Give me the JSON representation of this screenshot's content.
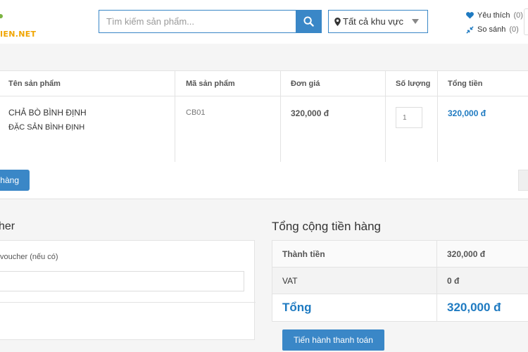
{
  "header": {
    "logo_text": "IEN.NET",
    "search_placeholder": "Tìm kiếm sản phẩm...",
    "region": "Tất cả khu vực",
    "favorites_label": "Yêu thích",
    "favorites_count": "(0)",
    "compare_label": "So sánh",
    "compare_count": "(0)"
  },
  "cart": {
    "columns": [
      "Tên sản phẩm",
      "Mã sản phẩm",
      "Đơn giá",
      "Số lượng",
      "Tổng tiền"
    ],
    "items": [
      {
        "name": "CHẢ BÒ BÌNH ĐỊNH",
        "description": "ĐẶC SẢN BÌNH ĐỊNH",
        "code": "CB01",
        "unit_price": "320,000 đ",
        "quantity": "1",
        "total": "320,000 đ"
      }
    ],
    "update_button": "hàng"
  },
  "voucher": {
    "title": "her",
    "label": "voucher (nếu có)"
  },
  "totals": {
    "title": "Tổng cộng tiền hàng",
    "rows": [
      {
        "label": "Thành tiền",
        "value": "320,000 đ"
      },
      {
        "label": "VAT",
        "value": "0 đ"
      },
      {
        "label": "Tổng",
        "value": "320,000 đ"
      }
    ],
    "checkout_button": "Tiến hành thanh toán"
  },
  "colors": {
    "accent": "#3a87c7",
    "price_blue": "#1e7ac1",
    "logo_yellow": "#f0a500"
  },
  "icons": {
    "search": "search-icon",
    "location": "map-pin-icon",
    "favorites": "heart-icon",
    "compare": "compare-arrows-icon"
  }
}
